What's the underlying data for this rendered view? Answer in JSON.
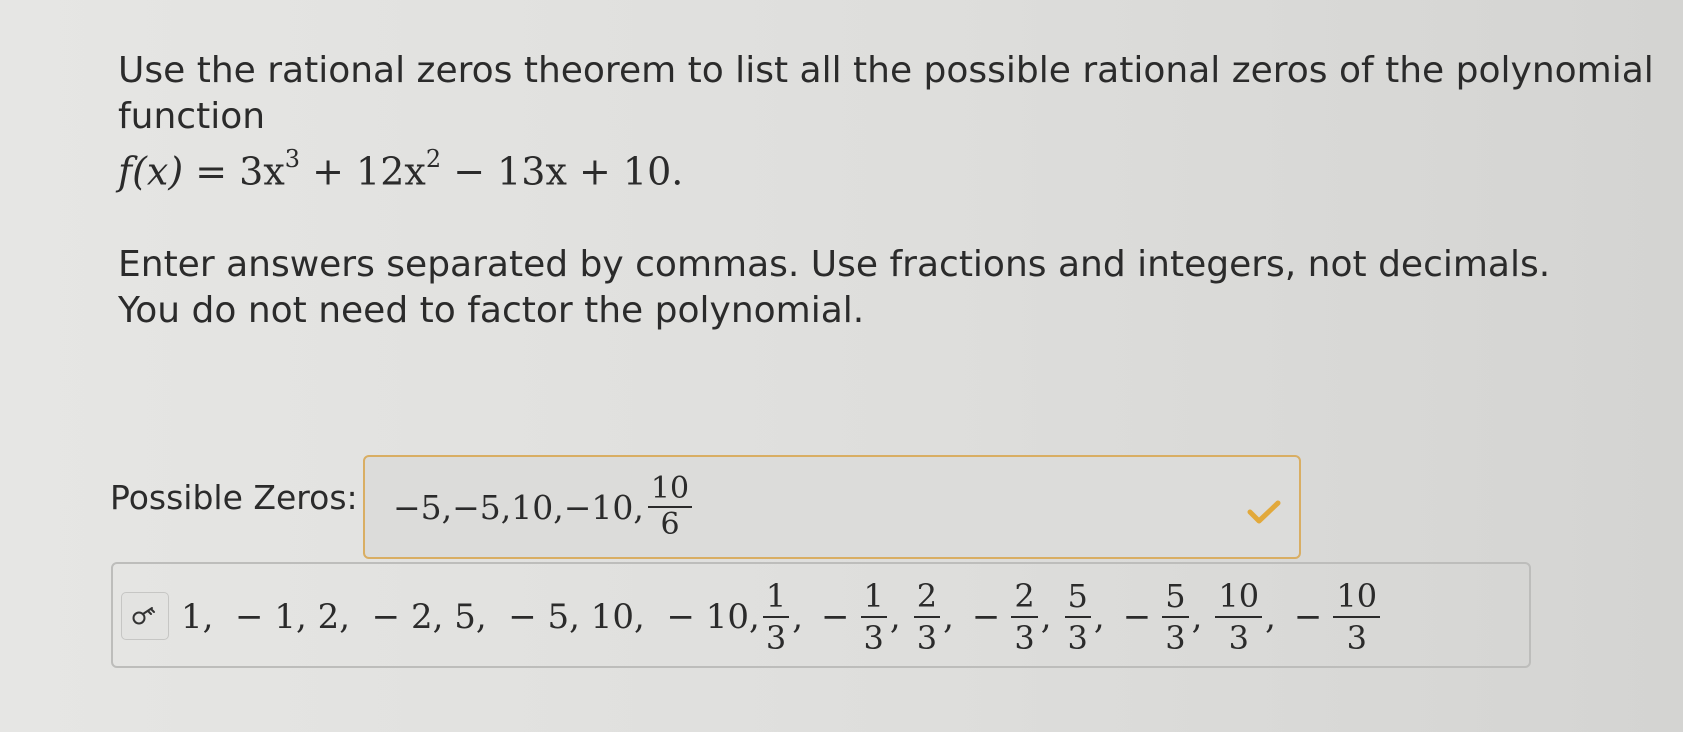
{
  "question": {
    "line1": "Use the rational zeros theorem to list all the possible rational zeros of the polynomial function",
    "formula": {
      "lhs": "f(x)",
      "eq": " = 3x",
      "exp1": "3",
      "mid": " + 12x",
      "exp2": "2",
      "tail": " − 13x + 10."
    },
    "instructions": "Enter answers separated by commas. Use fractions and integers, not decimals. You do not need to factor the polynomial."
  },
  "answer": {
    "label": "Possible Zeros:",
    "typed_prefix": "−5,−5,10,−10,",
    "frac_num": "10",
    "frac_den": "6",
    "status_icon": "check-icon"
  },
  "result": {
    "button_icon": "key-icon",
    "prefix": "1,  − 1, 2,  − 2, 5,  − 5, 10,  − 10,",
    "fractions": [
      {
        "sign": "",
        "num": "1",
        "den": "3"
      },
      {
        "sign": "−",
        "num": "1",
        "den": "3"
      },
      {
        "sign": "",
        "num": "2",
        "den": "3"
      },
      {
        "sign": "−",
        "num": "2",
        "den": "3"
      },
      {
        "sign": "",
        "num": "5",
        "den": "3"
      },
      {
        "sign": "−",
        "num": "5",
        "den": "3"
      },
      {
        "sign": "",
        "num": "10",
        "den": "3"
      },
      {
        "sign": "−",
        "num": "10",
        "den": "3"
      }
    ]
  },
  "colors": {
    "accent_border": "#d9ae63",
    "check": "#e2a93b"
  }
}
